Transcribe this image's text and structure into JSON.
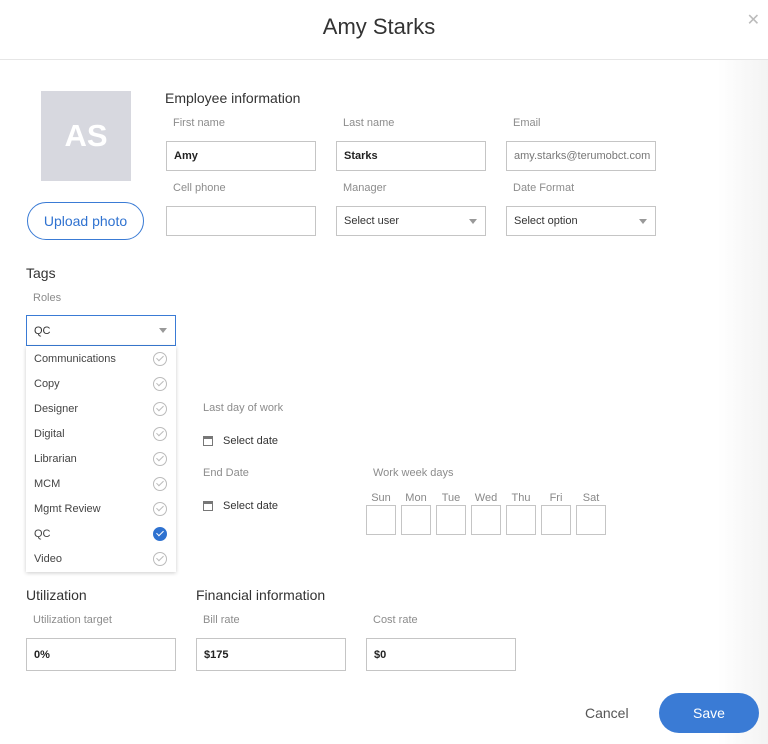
{
  "title": "Amy Starks",
  "avatar": {
    "initials": "AS"
  },
  "upload_label": "Upload photo",
  "employee": {
    "section": "Employee information",
    "first_name": {
      "label": "First name",
      "value": "Amy"
    },
    "last_name": {
      "label": "Last name",
      "value": "Starks"
    },
    "email": {
      "label": "Email",
      "value": "amy.starks@terumobct.com"
    },
    "cell": {
      "label": "Cell phone",
      "value": ""
    },
    "manager": {
      "label": "Manager",
      "value": "Select user"
    },
    "date_format": {
      "label": "Date Format",
      "value": "Select option"
    }
  },
  "tags": {
    "section": "Tags",
    "roles_label": "Roles",
    "roles_value": "QC",
    "options": [
      {
        "label": "Communications",
        "checked": false
      },
      {
        "label": "Copy",
        "checked": false
      },
      {
        "label": "Designer",
        "checked": false
      },
      {
        "label": "Digital",
        "checked": false
      },
      {
        "label": "Librarian",
        "checked": false
      },
      {
        "label": "MCM",
        "checked": false
      },
      {
        "label": "Mgmt Review",
        "checked": false
      },
      {
        "label": "QC",
        "checked": true
      },
      {
        "label": "Video",
        "checked": false
      }
    ]
  },
  "availability": {
    "last_day_label": "Last day of work",
    "last_day_value": "Select date",
    "end_date_label": "End Date",
    "end_date_value": "Select date",
    "work_week_label": "Work week days",
    "days": [
      "Sun",
      "Mon",
      "Tue",
      "Wed",
      "Thu",
      "Fri",
      "Sat"
    ]
  },
  "utilization": {
    "section": "Utilization",
    "target_label": "Utilization target",
    "target_value": "0%"
  },
  "financial": {
    "section": "Financial information",
    "bill_label": "Bill rate",
    "bill_value": "$175",
    "cost_label": "Cost rate",
    "cost_value": "$0"
  },
  "footer": {
    "cancel": "Cancel",
    "save": "Save"
  },
  "colors": {
    "accent": "#3a7bd5",
    "avatar_bg": "#d7d8df"
  }
}
